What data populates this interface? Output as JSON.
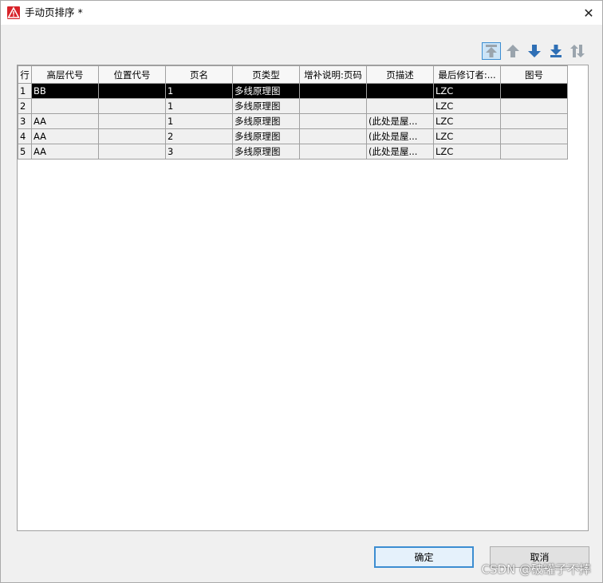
{
  "window": {
    "title": "手动页排序 *",
    "close_glyph": "✕"
  },
  "toolbar": {
    "buttons": [
      {
        "name": "move-to-top-button",
        "icon": "move-top-icon"
      },
      {
        "name": "move-up-button",
        "icon": "arrow-up-icon"
      },
      {
        "name": "move-down-button",
        "icon": "arrow-down-icon"
      },
      {
        "name": "move-to-bottom-button",
        "icon": "move-bottom-icon"
      },
      {
        "name": "swap-button",
        "icon": "swap-icon"
      }
    ]
  },
  "table": {
    "columns": [
      "行",
      "高层代号",
      "位置代号",
      "页名",
      "页类型",
      "增补说明:页码",
      "页描述",
      "最后修订者:...",
      "图号"
    ],
    "rows": [
      [
        "1",
        "BB",
        "",
        "1",
        "多线原理图",
        "",
        "",
        "LZC",
        ""
      ],
      [
        "2",
        "",
        "",
        "1",
        "多线原理图",
        "",
        "",
        "LZC",
        ""
      ],
      [
        "3",
        "AA",
        "",
        "1",
        "多线原理图",
        "",
        "(此处是屋...",
        "LZC",
        ""
      ],
      [
        "4",
        "AA",
        "",
        "2",
        "多线原理图",
        "",
        "(此处是屋...",
        "LZC",
        ""
      ],
      [
        "5",
        "AA",
        "",
        "3",
        "多线原理图",
        "",
        "(此处是屋...",
        "LZC",
        ""
      ]
    ],
    "selected_row": 0
  },
  "footer": {
    "ok_label": "确定",
    "cancel_label": "取消"
  },
  "watermark": "CSDN @破罐子不摔",
  "colors": {
    "accent": "#3c8dd1",
    "selection": "#000000",
    "icon_blue": "#2f6fb5",
    "icon_gray": "#9aa4ad"
  }
}
